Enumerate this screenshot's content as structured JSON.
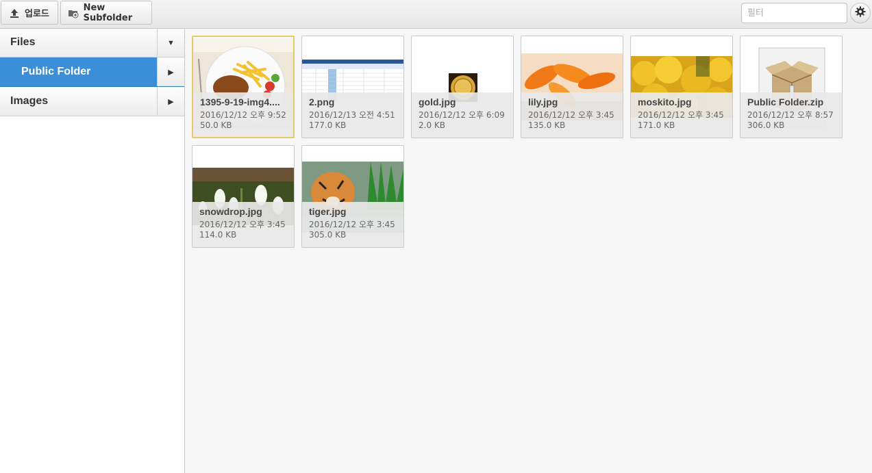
{
  "toolbar": {
    "upload_label": "업로드",
    "new_subfolder_label": "New Subfolder",
    "filter_placeholder": "필터"
  },
  "sidebar": {
    "items": [
      {
        "label": "Files",
        "toggle": "▼"
      },
      {
        "label": "Public Folder",
        "toggle": "▶"
      },
      {
        "label": "Images",
        "toggle": "▶"
      }
    ]
  },
  "files": [
    {
      "name": "1395-9-19-img4....",
      "date": "2016/12/12 오후 9:52",
      "size": "50.0 KB"
    },
    {
      "name": "2.png",
      "date": "2016/12/13 오전 4:51",
      "size": "177.0 KB"
    },
    {
      "name": "gold.jpg",
      "date": "2016/12/12 오후 6:09",
      "size": "2.0 KB"
    },
    {
      "name": "lily.jpg",
      "date": "2016/12/12 오후 3:45",
      "size": "135.0 KB"
    },
    {
      "name": "moskito.jpg",
      "date": "2016/12/12 오후 3:45",
      "size": "171.0 KB"
    },
    {
      "name": "Public Folder.zip",
      "date": "2016/12/12 오후 8:57",
      "size": "306.0 KB"
    },
    {
      "name": "snowdrop.jpg",
      "date": "2016/12/12 오후 3:45",
      "size": "114.0 KB"
    },
    {
      "name": "tiger.jpg",
      "date": "2016/12/12 오후 3:45",
      "size": "305.0 KB"
    }
  ],
  "colors": {
    "accent": "#3a8fd8",
    "selected_border": "#e8c96a"
  }
}
